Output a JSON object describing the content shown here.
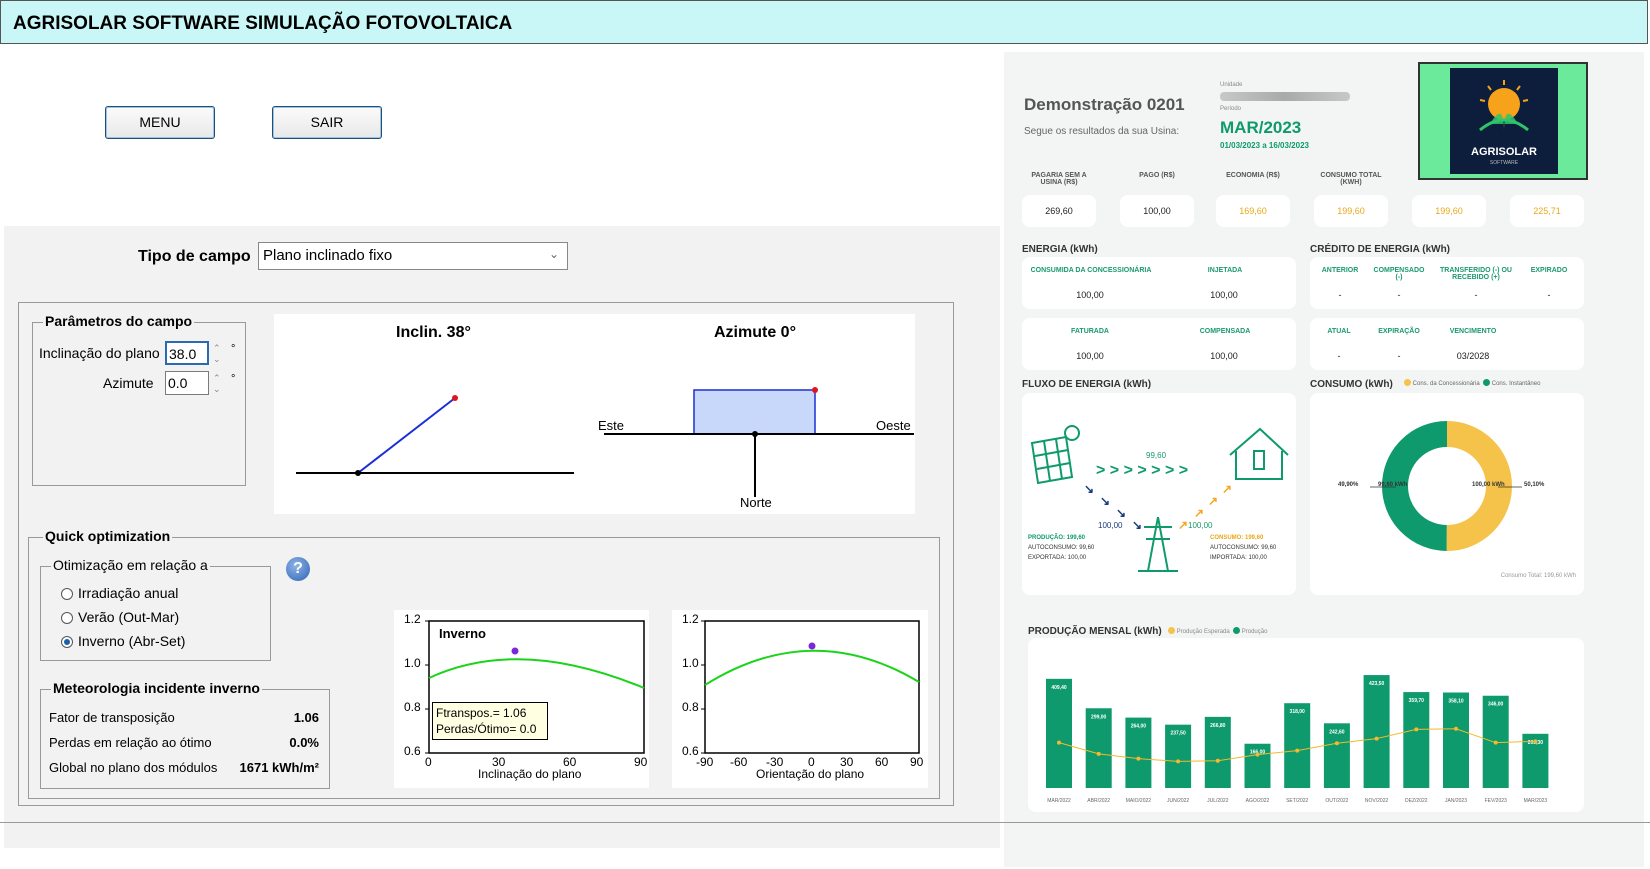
{
  "app_title": "AGRISOLAR SOFTWARE SIMULAÇÃO FOTOVOLTAICA",
  "buttons": {
    "menu": "MENU",
    "sair": "SAIR"
  },
  "field_type": {
    "label": "Tipo de campo",
    "value": "Plano inclinado fixo"
  },
  "params": {
    "title": "Parâmetros do campo",
    "tilt_label": "Inclinação do plano",
    "tilt_value": "38.0",
    "azimuth_label": "Azimute",
    "azimuth_value": "0.0",
    "unit": "°"
  },
  "diagram": {
    "tilt_title": "Inclin. 38°",
    "azimuth_title": "Azimute 0°",
    "east": "Este",
    "west": "Oeste",
    "north": "Norte"
  },
  "quick_opt": {
    "title": "Quick optimization",
    "group_title": "Otimização em relação a",
    "options": [
      "Irradiação anual",
      "Verão (Out-Mar)",
      "Inverno (Abr-Set)"
    ],
    "selected": 2,
    "help_icon": "question-circle-icon"
  },
  "meteo": {
    "title": "Meteorologia incidente inverno",
    "rows": [
      {
        "label": "Fator de transposição",
        "value": "1.06"
      },
      {
        "label": "Perdas em relação ao ótimo",
        "value": "0.0%"
      },
      {
        "label": "Global no plano dos módulos",
        "value": "1671 kWh/m²"
      }
    ]
  },
  "plot1": {
    "title": "Inverno",
    "xlabel": "Inclinação do plano",
    "xticks": [
      "0",
      "30",
      "60",
      "90"
    ],
    "yticks": [
      "0.6",
      "0.8",
      "1.0",
      "1.2"
    ],
    "tooltip1": "Ftranspos.= 1.06",
    "tooltip2": "Perdas/Ótimo= 0.0"
  },
  "plot2": {
    "xlabel": "Orientação do plano",
    "xticks": [
      "-90",
      "-60",
      "-30",
      "0",
      "30",
      "60",
      "90"
    ],
    "yticks": [
      "0.6",
      "0.8",
      "1.0",
      "1.2"
    ]
  },
  "dashboard": {
    "title": "Demonstração 0201",
    "subtitle": "Segue os resultados da sua Usina:",
    "unit_label": "Unidade",
    "period_label": "Período",
    "period": "MAR/2023",
    "period_range": "01/03/2023 a 16/03/2023",
    "logo_text": "AGRISOLAR",
    "logo_sub": "SOFTWARE",
    "kpis": [
      {
        "label": "PAGARIA SEM A USINA (R$)",
        "value": "269,60",
        "color": "#222222"
      },
      {
        "label": "PAGO (R$)",
        "value": "100,00",
        "color": "#222222"
      },
      {
        "label": "ECONOMIA (R$)",
        "value": "169,60",
        "color": "#e8a817"
      },
      {
        "label": "CONSUMO TOTAL (KWH)",
        "value": "199,60",
        "color": "#e8a817"
      },
      {
        "label": "",
        "value": "199,60",
        "color": "#e8a817"
      },
      {
        "label": "",
        "value": "225,71",
        "color": "#e8a817"
      }
    ],
    "energia": {
      "title": "ENERGIA (kWh)",
      "c1": "CONSUMIDA DA CONCESSIONÁRIA",
      "v1": "100,00",
      "c2": "INJETADA",
      "v2": "100,00",
      "c3": "FATURADA",
      "v3": "100,00",
      "c4": "COMPENSADA",
      "v4": "100,00"
    },
    "credito": {
      "title": "CRÉDITO DE ENERGIA (kWh)",
      "h": [
        "ANTERIOR",
        "COMPENSADO (-)",
        "TRANSFERIDO (-) OU RECEBIDO (+)",
        "EXPIRADO"
      ],
      "v": [
        "-",
        "-",
        "-",
        "-"
      ],
      "h2": [
        "ATUAL",
        "EXPIRAÇÃO",
        "VENCIMENTO"
      ],
      "v2": [
        "-",
        "-",
        "03/2028"
      ]
    },
    "fluxo": {
      "title": "FLUXO DE ENERGIA (kWh)",
      "top_value": "99,60",
      "left_value": "100,00",
      "right_value": "100,00",
      "prod_label": "PRODUÇÃO: 199,60",
      "auto_label": "AUTOCONSUMO: 99,60",
      "exp_label": "EXPORTADA: 100,00",
      "cons_label": "CONSUMO: 199,60",
      "auto2_label": "AUTOCONSUMO: 99,60",
      "imp_label": "IMPORTADA: 100,00"
    },
    "consumo": {
      "title": "CONSUMO (kWh)",
      "legend": [
        "Cons. da Concessionária",
        "Cons. Instantâneo"
      ],
      "left_pct": "49,90%",
      "left_val": "99,60 kWh",
      "right_val": "100,00 kWh",
      "right_pct": "50,10%",
      "total": "Consumo Total: 199,60 kWh",
      "shares": [
        50.1,
        49.9
      ]
    },
    "producao": {
      "title": "PRODUÇÃO MENSAL (kWh)",
      "legend": [
        "Produção Esperada",
        "Produção"
      ]
    }
  },
  "chart_data": {
    "type": "bar",
    "title": "PRODUÇÃO MENSAL (kWh)",
    "categories": [
      "MAR/2022",
      "ABR/2022",
      "MAIO/2022",
      "JUN/2022",
      "JUL/2022",
      "AGO/2022",
      "SET/2022",
      "OUT/2022",
      "NOV/2022",
      "DEZ/2022",
      "JAN/2023",
      "FEV/2023",
      "MAR/2023"
    ],
    "series": [
      {
        "name": "Produção",
        "values": [
          409.4,
          299.0,
          264.0,
          237.5,
          266.8,
          166.0,
          318.0,
          242.6,
          423.5,
          359.7,
          358.1,
          346.0,
          203.3
        ]
      },
      {
        "name": "Produção Esperada",
        "values": [
          170,
          128,
          110,
          100,
          102,
          125,
          140,
          168,
          185,
          220,
          222,
          170,
          175
        ]
      }
    ],
    "colors": {
      "bar": "#0e9a6c",
      "line": "#f5b82e"
    }
  },
  "colors": {
    "accent_green": "#0e9a6c",
    "accent_yellow": "#f5c349",
    "title_bg": "#c9f7f7"
  }
}
